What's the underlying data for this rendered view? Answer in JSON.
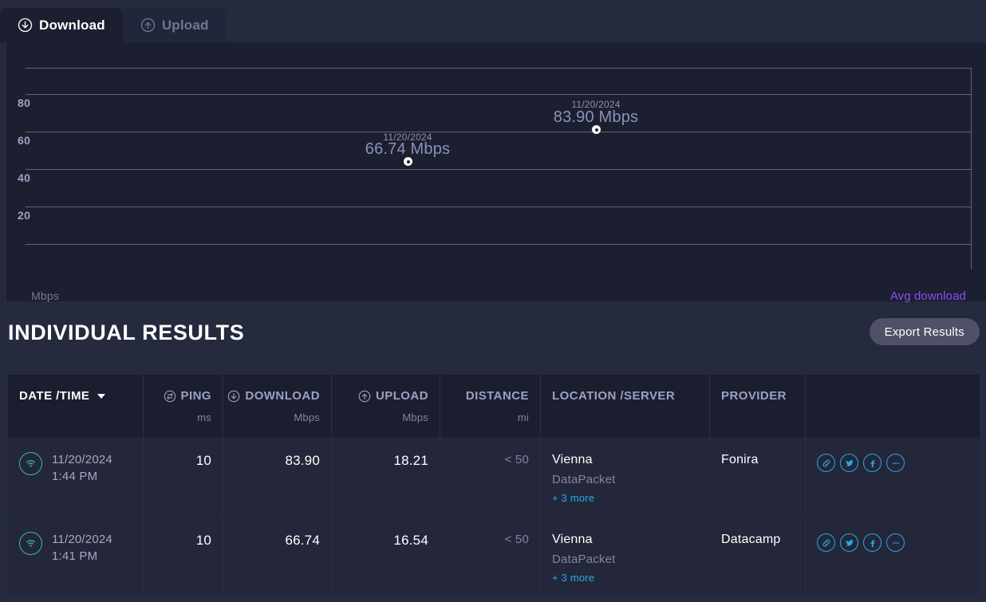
{
  "tabs": [
    {
      "label": "Download",
      "icon": "download-circle-icon",
      "active": true
    },
    {
      "label": "Upload",
      "icon": "upload-circle-icon",
      "active": false
    }
  ],
  "chart": {
    "unit_label": "Mbps",
    "legend_label": "Avg download",
    "legend_color": "#8b4dfa"
  },
  "chart_data": {
    "type": "scatter",
    "title": "",
    "xlabel": "",
    "ylabel": "Mbps",
    "ylim": [
      0,
      100
    ],
    "yticks": [
      20,
      40,
      60,
      80
    ],
    "gridlines": [
      0,
      20,
      40,
      60,
      80,
      100
    ],
    "grid": true,
    "legend": "Avg download",
    "legend_position": "bottom-right",
    "points": [
      {
        "date": "11/20/2024",
        "value": 66.74,
        "label": "66.74 Mbps"
      },
      {
        "date": "11/20/2024",
        "value": 83.9,
        "label": "83.90 Mbps"
      }
    ]
  },
  "results": {
    "title": "INDIVIDUAL RESULTS",
    "export_label": "Export Results"
  },
  "table": {
    "columns": [
      {
        "label": "DATE /TIME",
        "sub": "",
        "icon": "",
        "sort": true
      },
      {
        "label": "PING",
        "sub": "ms",
        "icon": "ping-icon"
      },
      {
        "label": "DOWNLOAD",
        "sub": "Mbps",
        "icon": "download-circle-icon"
      },
      {
        "label": "UPLOAD",
        "sub": "Mbps",
        "icon": "upload-circle-icon"
      },
      {
        "label": "DISTANCE",
        "sub": "mi",
        "icon": ""
      },
      {
        "label": "LOCATION /SERVER",
        "sub": "",
        "icon": ""
      },
      {
        "label": "PROVIDER",
        "sub": "",
        "icon": ""
      },
      {
        "label": "",
        "sub": "",
        "icon": ""
      }
    ],
    "rows": [
      {
        "connection_icon": "wifi-icon",
        "date": "11/20/2024",
        "time": "1:44 PM",
        "ping": "10",
        "download": "83.90",
        "upload": "18.21",
        "distance": "< 50",
        "location": "Vienna",
        "server": "DataPacket",
        "more": "+ 3 more",
        "provider": "Fonira",
        "actions": [
          "link-icon",
          "twitter-icon",
          "facebook-icon",
          "ellipsis-icon"
        ]
      },
      {
        "connection_icon": "wifi-icon",
        "date": "11/20/2024",
        "time": "1:41 PM",
        "ping": "10",
        "download": "66.74",
        "upload": "16.54",
        "distance": "< 50",
        "location": "Vienna",
        "server": "DataPacket",
        "more": "+ 3 more",
        "provider": "Datacamp",
        "actions": [
          "link-icon",
          "twitter-icon",
          "facebook-icon",
          "ellipsis-icon"
        ]
      }
    ]
  }
}
